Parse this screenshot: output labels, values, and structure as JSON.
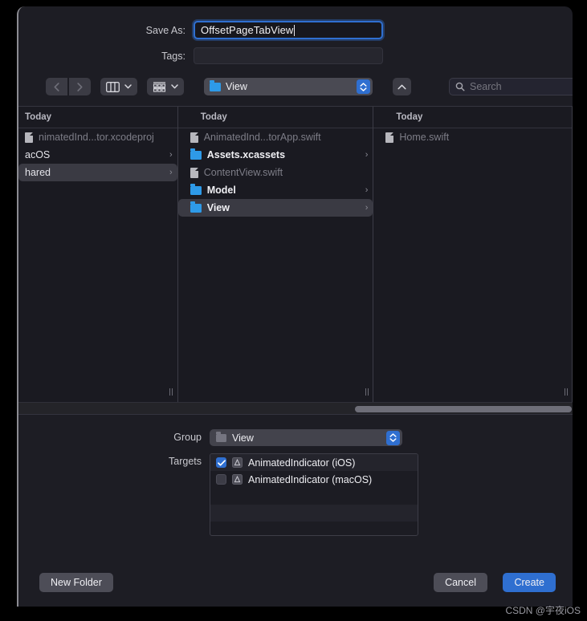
{
  "dialog": {
    "save_as_label": "Save As:",
    "save_as_value": "OffsetPageTabView",
    "tags_label": "Tags:",
    "tags_value": ""
  },
  "toolbar": {
    "back_icon": "chevron-left-icon",
    "forward_icon": "chevron-right-icon",
    "column_view_icon": "column-view-icon",
    "group_view_icon": "group-grid-icon",
    "path_label": "View",
    "stepper_icon": "stepper-updown-icon",
    "up_icon": "chevron-up-icon",
    "search_icon": "search-icon",
    "search_placeholder": "Search"
  },
  "browser": {
    "columns": [
      {
        "header": "Today",
        "items": [
          {
            "name": "nimatedInd...tor.xcodeproj",
            "kind": "file",
            "state": "dim",
            "chevron": false
          },
          {
            "name": "acOS",
            "kind": "none",
            "state": "plain",
            "chevron": true
          },
          {
            "name": "hared",
            "kind": "none",
            "state": "plain",
            "chevron": true,
            "selected": true
          }
        ]
      },
      {
        "header": "Today",
        "items": [
          {
            "name": "AnimatedInd...torApp.swift",
            "kind": "file",
            "state": "dim",
            "chevron": false
          },
          {
            "name": "Assets.xcassets",
            "kind": "folder",
            "state": "bright",
            "chevron": true
          },
          {
            "name": "ContentView.swift",
            "kind": "file",
            "state": "dim",
            "chevron": false
          },
          {
            "name": "Model",
            "kind": "folder",
            "state": "bright",
            "chevron": true
          },
          {
            "name": "View",
            "kind": "folder",
            "state": "bright",
            "chevron": true,
            "selected": true
          }
        ]
      },
      {
        "header": "Today",
        "items": [
          {
            "name": "Home.swift",
            "kind": "file",
            "state": "dim",
            "chevron": false
          }
        ]
      }
    ]
  },
  "options": {
    "group_label": "Group",
    "group_value": "View",
    "group_icon": "folder-icon",
    "targets_label": "Targets",
    "targets": [
      {
        "name": "AnimatedIndicator (iOS)",
        "checked": true
      },
      {
        "name": "AnimatedIndicator (macOS)",
        "checked": false
      }
    ]
  },
  "footer": {
    "new_folder_label": "New Folder",
    "cancel_label": "Cancel",
    "create_label": "Create"
  },
  "watermark": "CSDN @宇夜iOS",
  "colors": {
    "accent": "#2f6fd0",
    "folder_blue": "#2e9ae8",
    "window_bg": "#1d1d24"
  }
}
